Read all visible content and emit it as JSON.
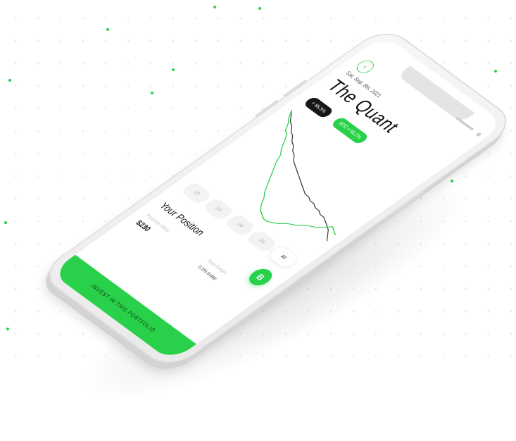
{
  "app": {
    "date": "Sat, Sep. 8th, 2021",
    "title": "The Quant",
    "badge_left": "+ 85,3%",
    "badge_btc": "BTC",
    "badge_right": "+ 65,2%",
    "back_icon": "back-arrow-icon",
    "accent_color": "#29d14a"
  },
  "chart_data": {
    "type": "line",
    "series": [
      {
        "values": [
          100,
          98,
          96,
          95,
          93,
          92,
          90,
          89,
          87,
          86,
          84,
          83,
          82,
          81,
          80,
          79,
          78,
          77,
          76,
          76,
          75,
          75,
          74,
          74,
          73,
          73,
          72,
          71,
          70,
          68,
          66
        ]
      },
      {
        "values": [
          100,
          97,
          95,
          92,
          91,
          88,
          85,
          83,
          79,
          76,
          73,
          70,
          67,
          65,
          62,
          60,
          59,
          58,
          58,
          59,
          60,
          62,
          63,
          64,
          66,
          67,
          68,
          70,
          72,
          71,
          70
        ]
      }
    ]
  },
  "ranges": [
    "1D",
    "1W",
    "1M",
    "3M",
    "All"
  ],
  "active_range": "All",
  "coin_label": "B",
  "position": {
    "title": "Your Position",
    "value_label": "Portfolio Value",
    "value": "$230",
    "return_label": "Total Return",
    "return_value": "0.5% today"
  },
  "invest_button": "INVEST IN THIS PORTFOLIO"
}
